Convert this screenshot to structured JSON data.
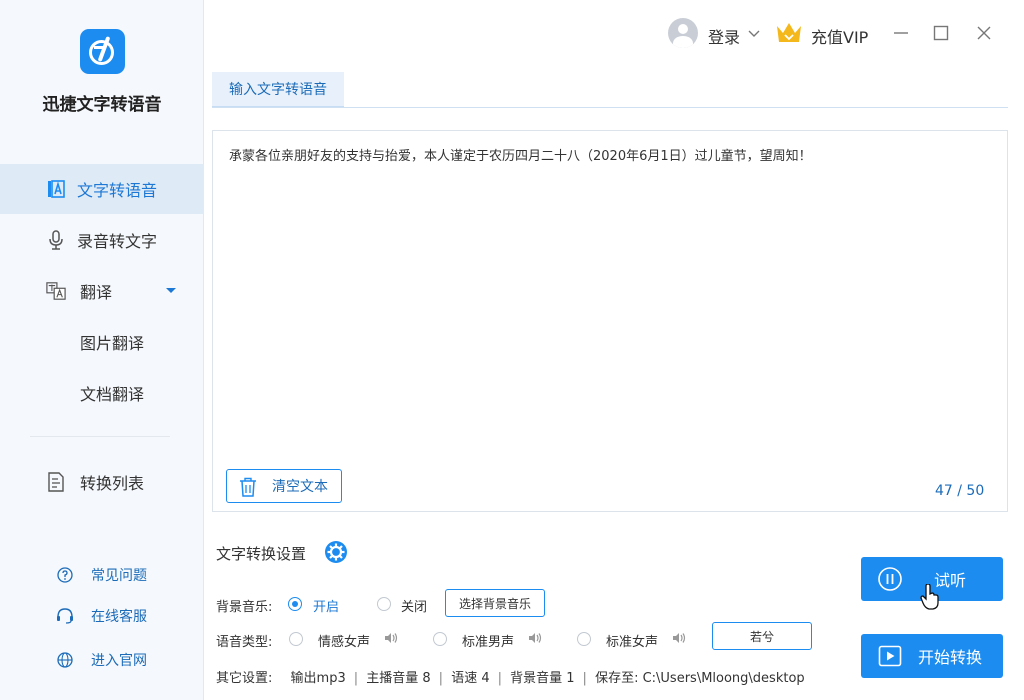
{
  "app": {
    "name": "迅捷文字转语音"
  },
  "header": {
    "login_label": "登录",
    "vip_label": "充值VIP"
  },
  "sidebar": {
    "items": [
      {
        "label": "文字转语音",
        "icon": "text-a-icon",
        "active": true
      },
      {
        "label": "录音转文字",
        "icon": "microphone-icon"
      },
      {
        "label": "翻译",
        "icon": "translate-icon"
      },
      {
        "label": "图片翻译"
      },
      {
        "label": "文档翻译"
      },
      {
        "label": "转换列表",
        "icon": "document-list-icon"
      }
    ],
    "help": [
      {
        "label": "常见问题",
        "icon": "question-icon"
      },
      {
        "label": "在线客服",
        "icon": "headset-icon"
      },
      {
        "label": "进入官网",
        "icon": "globe-icon"
      }
    ]
  },
  "tabs": [
    {
      "label": "输入文字转语音"
    }
  ],
  "editor": {
    "text": "承蒙各位亲朋好友的支持与抬爱，本人谨定于农历四月二十八（2020年6月1日）过儿童节，望周知！",
    "clear_label": "清空文本",
    "counter": "47 / 50"
  },
  "settings": {
    "title": "文字转换设置",
    "bgm": {
      "label": "背景音乐:",
      "options": [
        "开启",
        "关闭"
      ],
      "selected": "开启",
      "choose_button": "选择背景音乐"
    },
    "voice": {
      "label": "语音类型:",
      "options": [
        "情感女声",
        "标准男声",
        "标准女声"
      ],
      "more_button": "若兮"
    },
    "other": {
      "label": "其它设置:",
      "items": [
        "输出mp3",
        "主播音量 8",
        "语速 4",
        "背景音量 1",
        "保存至: C:\\Users\\Mloong\\desktop"
      ]
    }
  },
  "actions": {
    "preview_label": "试听",
    "convert_label": "开始转换"
  },
  "colors": {
    "accent": "#1c8cf0",
    "sidebar_bg": "#f5f8fc",
    "vip": "#f4b81c"
  }
}
